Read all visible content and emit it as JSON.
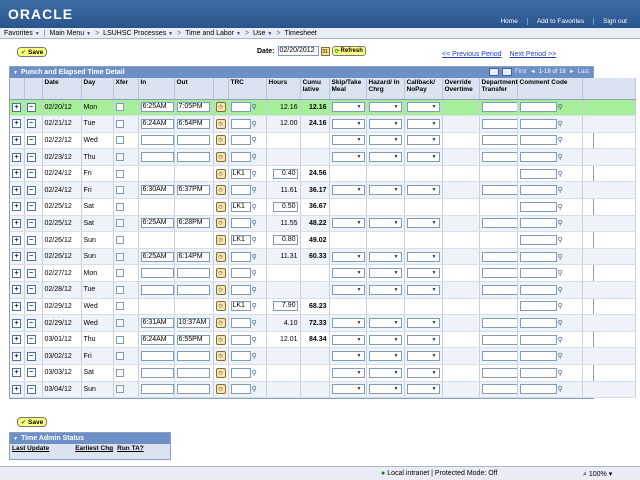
{
  "header": {
    "logo": "ORACLE",
    "links": [
      "Home",
      "Add to Favorites",
      "Sign out"
    ]
  },
  "menu": {
    "items": [
      "Favorites",
      "Main Menu",
      "LSUHSC Processes",
      "Time and Labor",
      "Use",
      "Timesheet"
    ]
  },
  "toolbar": {
    "save_label": "Save",
    "date_label": "Date:",
    "date_value": "02/20/2012",
    "refresh_label": "Refresh",
    "prev_period": "<< Previous Period",
    "next_period": "Next Period >>"
  },
  "grid": {
    "title": "Punch and Elapsed Time Detail",
    "first": "First",
    "count": "1-18 of 18",
    "last": "Last",
    "columns": [
      "Date",
      "Day",
      "Xfer",
      "In",
      "Out",
      "TRC",
      "Hours",
      "Cumu lative",
      "Skip/Take Meal",
      "Hazard/ In Chrg",
      "Callback/ NoPay",
      "Override Overtime",
      "Department Transfer",
      "Comment Code"
    ],
    "rows": [
      {
        "date": "02/20/12",
        "day": "Mon",
        "in": "6:25AM",
        "out": "7:05PM",
        "trc": "",
        "hours": "12.16",
        "cumulative": "12.16"
      },
      {
        "date": "02/21/12",
        "day": "Tue",
        "in": "6:24AM",
        "out": "6:54PM",
        "trc": "",
        "hours": "12.00",
        "cumulative": "24.16"
      },
      {
        "date": "02/22/12",
        "day": "Wed",
        "in": "",
        "out": "",
        "trc": "",
        "hours": "",
        "cumulative": ""
      },
      {
        "date": "02/23/12",
        "day": "Thu",
        "in": "",
        "out": "",
        "trc": "",
        "hours": "",
        "cumulative": ""
      },
      {
        "date": "02/24/12",
        "day": "Fri",
        "in": "",
        "out": "",
        "trc": "LK1",
        "hours": "0.40",
        "cumulative": "24.56"
      },
      {
        "date": "02/24/12",
        "day": "Fri",
        "in": "6:30AM",
        "out": "6:37PM",
        "trc": "",
        "hours": "11.61",
        "cumulative": "36.17"
      },
      {
        "date": "02/25/12",
        "day": "Sat",
        "in": "",
        "out": "",
        "trc": "LK1",
        "hours": "0.50",
        "cumulative": "36.67"
      },
      {
        "date": "02/25/12",
        "day": "Sat",
        "in": "6:25AM",
        "out": "6:28PM",
        "trc": "",
        "hours": "11.55",
        "cumulative": "48.22"
      },
      {
        "date": "02/26/12",
        "day": "Sun",
        "in": "",
        "out": "",
        "trc": "LK1",
        "hours": "0.80",
        "cumulative": "49.02"
      },
      {
        "date": "02/26/12",
        "day": "Sun",
        "in": "6:25AM",
        "out": "6:14PM",
        "trc": "",
        "hours": "11.31",
        "cumulative": "60.33"
      },
      {
        "date": "02/27/12",
        "day": "Mon",
        "in": "",
        "out": "",
        "trc": "",
        "hours": "",
        "cumulative": ""
      },
      {
        "date": "02/28/12",
        "day": "Tue",
        "in": "",
        "out": "",
        "trc": "",
        "hours": "",
        "cumulative": ""
      },
      {
        "date": "02/29/12",
        "day": "Wed",
        "in": "",
        "out": "",
        "trc": "LK1",
        "hours": "7.90",
        "cumulative": "68.23"
      },
      {
        "date": "02/29/12",
        "day": "Wed",
        "in": "6:31AM",
        "out": "10:37AM",
        "trc": "",
        "hours": "4.10",
        "cumulative": "72.33"
      },
      {
        "date": "03/01/12",
        "day": "Thu",
        "in": "6:24AM",
        "out": "6:55PM",
        "trc": "",
        "hours": "12.01",
        "cumulative": "84.34"
      },
      {
        "date": "03/02/12",
        "day": "Fri",
        "in": "",
        "out": "",
        "trc": "",
        "hours": "",
        "cumulative": ""
      },
      {
        "date": "03/03/12",
        "day": "Sat",
        "in": "",
        "out": "",
        "trc": "",
        "hours": "",
        "cumulative": ""
      },
      {
        "date": "03/04/12",
        "day": "Sun",
        "in": "",
        "out": "",
        "trc": "",
        "hours": "",
        "cumulative": ""
      }
    ]
  },
  "time_admin": {
    "title": "Time Admin Status",
    "columns": [
      "Last Update",
      "Earliest Chg",
      "Run TA?"
    ]
  },
  "statusbar": {
    "zone": "Local intranet | Protected Mode: Off",
    "zoom": "100%"
  },
  "colors": {
    "header_blue": "#2b548c",
    "grid_title_blue": "#6c8fc6",
    "highlight_green": "#a6ee9a",
    "button_yellow": "#ffff80"
  }
}
